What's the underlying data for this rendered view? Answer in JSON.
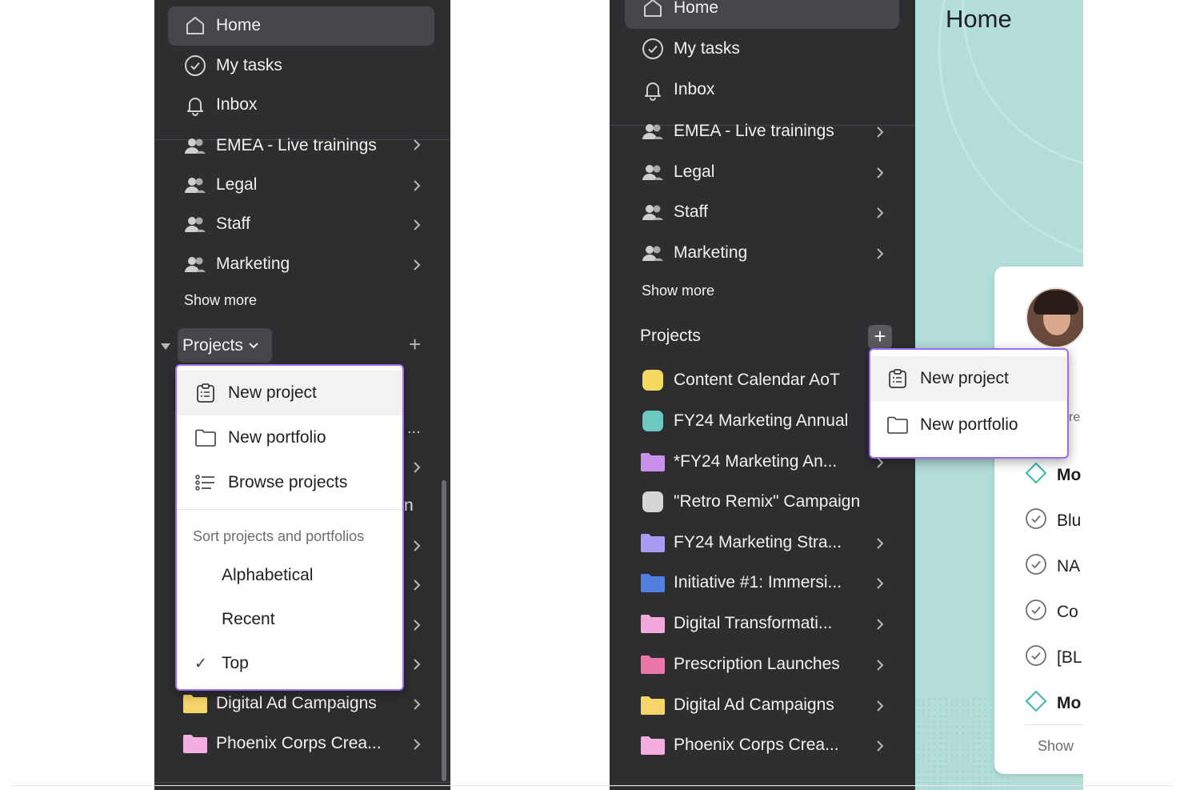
{
  "left": {
    "nav": [
      "Home",
      "My tasks",
      "Inbox"
    ],
    "teams": [
      "EMEA - Live trainings",
      "Legal",
      "Staff",
      "Marketing"
    ],
    "show_more": "Show more",
    "projects_label": "Projects",
    "projects_chevron": "⌄",
    "add": "+",
    "hidden_glyphs": [
      "...",
      "n"
    ],
    "bottom_projects": [
      "Digital Ad Campaigns",
      "Phoenix Corps Crea..."
    ],
    "menu": {
      "new_project": "New project",
      "new_portfolio": "New portfolio",
      "browse_projects": "Browse projects",
      "sort_header": "Sort projects and portfolios",
      "sort_options": [
        "Alphabetical",
        "Recent",
        "Top"
      ],
      "checkmark": "✓"
    }
  },
  "right": {
    "nav": [
      "Home",
      "My tasks",
      "Inbox"
    ],
    "teams": [
      "EMEA - Live trainings",
      "Legal",
      "Staff",
      "Marketing"
    ],
    "show_more": "Show more",
    "projects_label": "Projects",
    "add": "+",
    "projects": [
      {
        "name": "Content Calendar AoT",
        "icon": "yellow-swatch-icon",
        "color": "#f5d862"
      },
      {
        "name": "FY24 Marketing Annual",
        "icon": "teal-swatch-icon",
        "color": "#6cc9c2"
      },
      {
        "name": "*FY24 Marketing An...",
        "icon": "purple-folder-icon",
        "color": "#c890e8"
      },
      {
        "name": "\"Retro Remix\" Campaign",
        "icon": "gray-swatch-icon",
        "color": "#d6d6d6"
      },
      {
        "name": "FY24 Marketing Stra...",
        "icon": "lavender-folder-icon",
        "color": "#a79cf0"
      },
      {
        "name": "Initiative #1: Immersi...",
        "icon": "blue-folder-icon",
        "color": "#4f7fe0"
      },
      {
        "name": "Digital Transformati...",
        "icon": "pink-folder-icon",
        "color": "#f2a8dc"
      },
      {
        "name": "Prescription Launches",
        "icon": "rose-folder-icon",
        "color": "#eb74a8"
      },
      {
        "name": "Digital Ad Campaigns",
        "icon": "yellow-folder-icon",
        "color": "#f6d66a"
      },
      {
        "name": "Phoenix Corps Crea...",
        "icon": "pink-folder-icon",
        "color": "#f4aee0"
      }
    ],
    "menu": {
      "new_project": "New project",
      "new_portfolio": "New portfolio"
    }
  },
  "home": {
    "title": "Home",
    "partial_letter": "re",
    "tasks": [
      "Mo",
      "Blu",
      "NA",
      "Co",
      "[BL",
      "Mo"
    ],
    "show": "Show"
  },
  "colors": {
    "sidebar_bg": "#2e2e30",
    "highlight": "#9b6cf0",
    "home_bg": "#b2ddd9"
  }
}
